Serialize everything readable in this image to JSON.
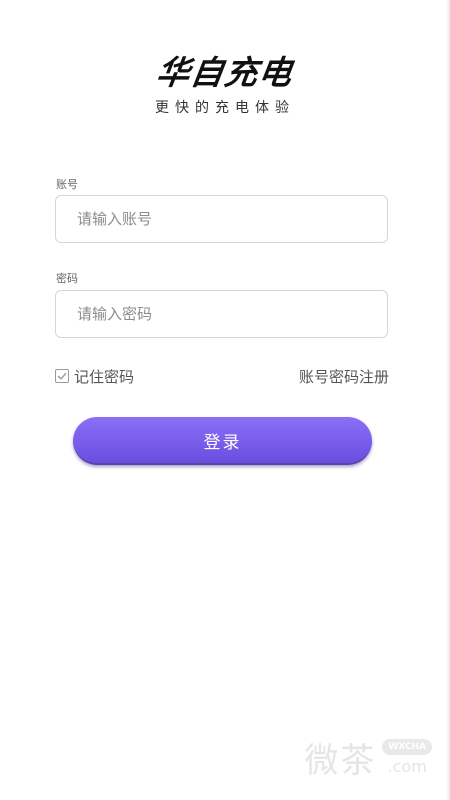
{
  "brand": {
    "title": "华自充电",
    "slogan": "更快的充电体验"
  },
  "form": {
    "account": {
      "label": "账号",
      "placeholder": "请输入账号",
      "value": ""
    },
    "password": {
      "label": "密码",
      "placeholder": "请输入密码",
      "value": ""
    },
    "remember": {
      "label": "记住密码",
      "checked": true
    },
    "register_link": "账号密码注册",
    "login_button": "登录"
  },
  "watermark": {
    "text": "微茶",
    "badge": "WXCHA",
    "domain": ".com"
  },
  "colors": {
    "accent_top": "#8a6ff7",
    "accent_bottom": "#6a4ee0",
    "text_primary": "#111111",
    "text_secondary": "#555555",
    "border": "#d6d6d6"
  },
  "icons": {
    "checkbox": "checkmark-icon"
  }
}
